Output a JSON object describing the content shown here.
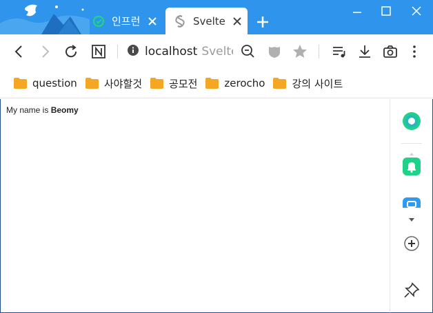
{
  "tabs": [
    {
      "label": "인프런",
      "icon": "inflearn-favicon-icon",
      "active": false
    },
    {
      "label": "Svelte",
      "icon": "svelte-favicon-icon",
      "active": true
    }
  ],
  "toolbar": {
    "url_host": "localhost",
    "url_page_title": "Svelte"
  },
  "bookmarks": [
    {
      "label": "question"
    },
    {
      "label": "사야할것"
    },
    {
      "label": "공모전"
    },
    {
      "label": "zerocho"
    },
    {
      "label": "강의 사이트"
    }
  ],
  "page": {
    "text_prefix": "My name is ",
    "name": "Beomy"
  },
  "colors": {
    "titlebar": "#2f95ec",
    "folder": "#f5a623",
    "accent_green": "#1fd28a",
    "accent_blue": "#2f9bf0"
  }
}
